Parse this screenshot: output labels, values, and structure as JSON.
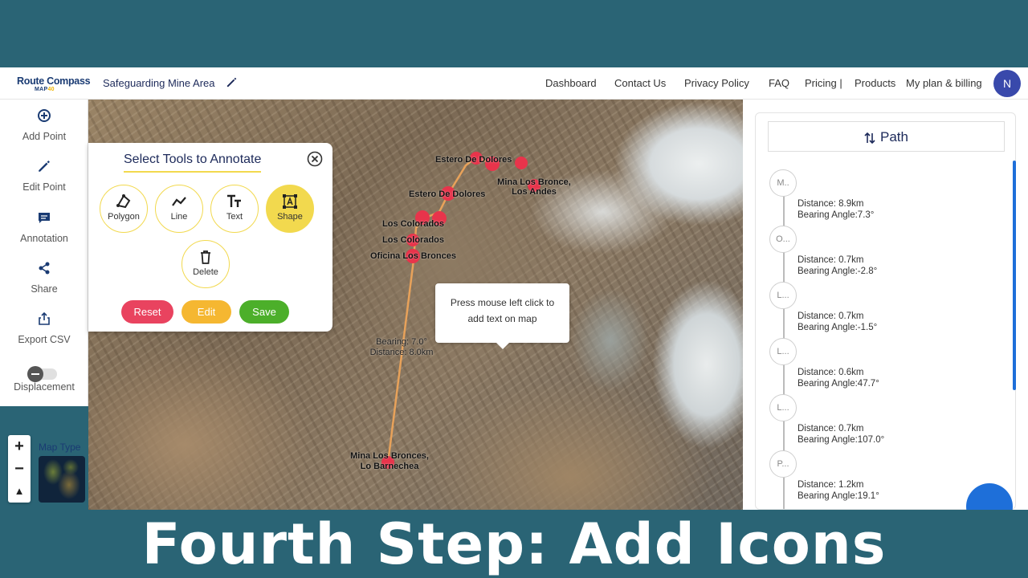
{
  "header": {
    "logo_main": "Route Compass",
    "logo_sub_prefix": "MAP",
    "logo_sub_suffix": "40",
    "project_title": "Safeguarding Mine Area",
    "nav_links": [
      "Dashboard",
      "Contact Us",
      "Privacy Policy",
      "FAQ",
      "Pricing |",
      "Products",
      "My plan & billing"
    ],
    "avatar_initial": "N"
  },
  "sidebar": {
    "items": [
      {
        "label": "Add Point",
        "icon": "add-point-icon"
      },
      {
        "label": "Edit Point",
        "icon": "pencil-icon"
      },
      {
        "label": "Annotation",
        "icon": "annotation-icon"
      },
      {
        "label": "Share",
        "icon": "share-icon"
      },
      {
        "label": "Export CSV",
        "icon": "export-icon"
      }
    ],
    "displacement_label": "Displacement",
    "displacement_on": false
  },
  "map_controls": {
    "zoom_in": "+",
    "zoom_out": "−",
    "compass": "▲",
    "map_type_label": "Map Type"
  },
  "annotate_panel": {
    "title": "Select Tools to Annotate",
    "tools": [
      {
        "label": "Polygon",
        "icon": "polygon-icon",
        "active": false
      },
      {
        "label": "Line",
        "icon": "line-icon",
        "active": false
      },
      {
        "label": "Text",
        "icon": "text-icon",
        "active": false
      },
      {
        "label": "Shape",
        "icon": "shape-icon",
        "active": true
      },
      {
        "label": "Delete",
        "icon": "trash-icon",
        "active": false
      }
    ],
    "actions": [
      {
        "label": "Reset",
        "color": "#e9435f"
      },
      {
        "label": "Edit",
        "color": "#f5b731"
      },
      {
        "label": "Save",
        "color": "#4caf2a"
      }
    ]
  },
  "tooltip": {
    "line1": "Press mouse left click to",
    "line2": "add text on map"
  },
  "map_labels": [
    "Estero De Dolores",
    "Mina Los Bronce,",
    "Los Andes",
    "Estero De Dolores",
    "Los Colorados",
    "Los Colorados",
    "Oficina Los Bronces",
    "Bearing: 7.0°",
    "Distance: 8.0km",
    "Mina Los Bronces,",
    "Lo Barnechea"
  ],
  "path_panel": {
    "title": "Path",
    "stops": [
      "M..",
      "O...",
      "L...",
      "L...",
      "L...",
      "P..."
    ],
    "segments": [
      {
        "distance": "Distance: 8.9km",
        "bearing": "Bearing Angle:7.3°"
      },
      {
        "distance": "Distance: 0.7km",
        "bearing": "Bearing Angle:-2.8°"
      },
      {
        "distance": "Distance: 0.7km",
        "bearing": "Bearing Angle:-1.5°"
      },
      {
        "distance": "Distance: 0.6km",
        "bearing": "Bearing Angle:47.7°"
      },
      {
        "distance": "Distance: 0.7km",
        "bearing": "Bearing Angle:107.0°"
      },
      {
        "distance": "Distance: 1.2km",
        "bearing": "Bearing Angle:19.1°"
      }
    ]
  },
  "caption": "Fourth Step: Add Icons",
  "colors": {
    "banner": "#2a6475",
    "accent_yellow": "#f2d94e",
    "brand_navy": "#1a3b73",
    "route_line": "#e8a25a",
    "marker": "#e8344b",
    "scroll_blue": "#1e6fd9"
  }
}
